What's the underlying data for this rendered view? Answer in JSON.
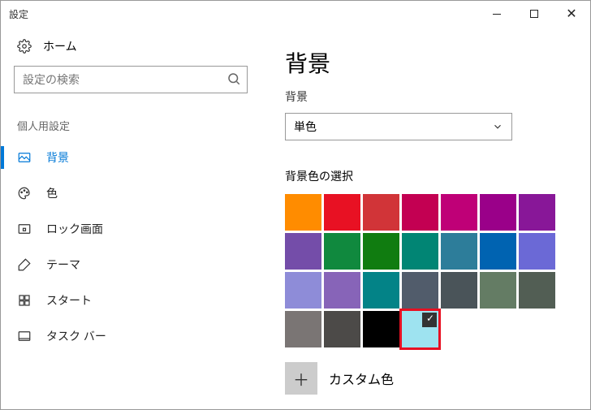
{
  "window": {
    "title": "設定"
  },
  "sidebar": {
    "home": "ホーム",
    "search_placeholder": "設定の検索",
    "group": "個人用設定",
    "items": [
      {
        "label": "背景"
      },
      {
        "label": "色"
      },
      {
        "label": "ロック画面"
      },
      {
        "label": "テーマ"
      },
      {
        "label": "スタート"
      },
      {
        "label": "タスク バー"
      }
    ]
  },
  "main": {
    "title": "背景",
    "bg_label": "背景",
    "bg_value": "単色",
    "color_label": "背景色の選択",
    "custom_label": "カスタム色",
    "swatches": [
      "#ff8c00",
      "#e81123",
      "#d13438",
      "#c30052",
      "#bf0077",
      "#9a0089",
      "#881798",
      "#744da9",
      "#10893e",
      "#107c10",
      "#018574",
      "#2d7d9a",
      "#0063b1",
      "#6b69d6",
      "#8e8cd8",
      "#8764b8",
      "#038387",
      "#515c6b",
      "#4a5459",
      "#647c64",
      "#525e54",
      "#7a7574",
      "#4c4a48",
      "#000000",
      "#9ee3f0"
    ],
    "selected_index": 24
  }
}
